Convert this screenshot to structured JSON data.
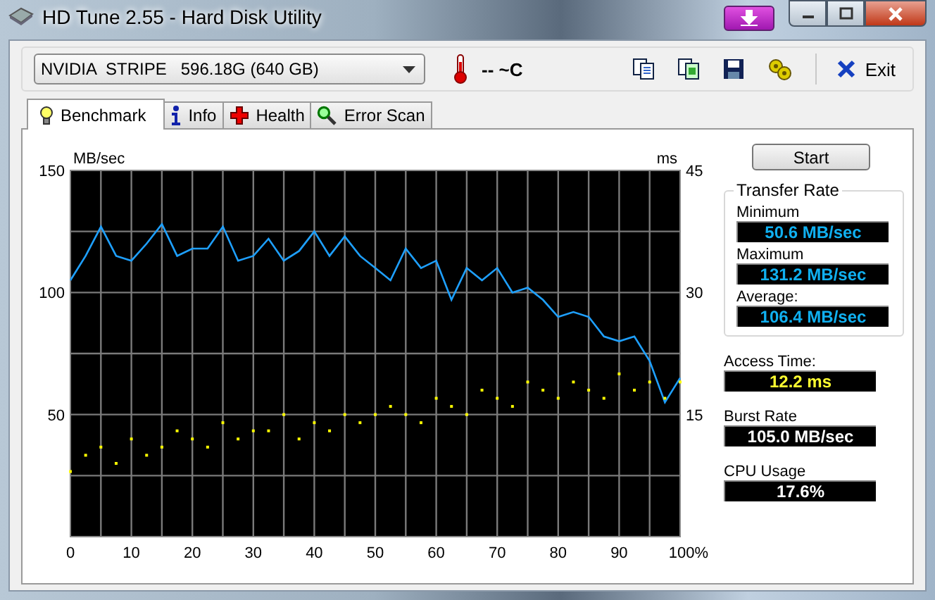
{
  "window": {
    "title": "HD Tune 2.55 - Hard Disk Utility"
  },
  "toolbar": {
    "drive": "NVIDIA  STRIPE   596.18G (640 GB)",
    "temperature": "-- ~C",
    "exit_label": "Exit"
  },
  "tabs": [
    {
      "label": "Benchmark",
      "selected": true,
      "kind": "bulb"
    },
    {
      "label": "Info",
      "selected": false,
      "kind": "info"
    },
    {
      "label": "Health",
      "selected": false,
      "kind": "health"
    },
    {
      "label": "Error Scan",
      "selected": false,
      "kind": "scan"
    }
  ],
  "benchmark": {
    "start_button": "Start",
    "transfer_rate": {
      "title": "Transfer Rate",
      "items": [
        {
          "label": "Minimum",
          "value": "50.6 MB/sec"
        },
        {
          "label": "Maximum",
          "value": "131.2 MB/sec"
        },
        {
          "label": "Average:",
          "value": "106.4 MB/sec"
        }
      ]
    },
    "stats": [
      {
        "label": "Access Time:",
        "value": "12.2 ms",
        "kind": "access"
      },
      {
        "label": "Burst Rate",
        "value": "105.0 MB/sec",
        "kind": "plain"
      },
      {
        "label": "CPU Usage",
        "value": "17.6%",
        "kind": "plain"
      }
    ],
    "chart_data": {
      "type": "line",
      "ylabel": "MB/sec",
      "y2label": "ms",
      "xlim": [
        0,
        100
      ],
      "ylim": [
        0,
        150
      ],
      "y2lim": [
        0,
        45
      ],
      "xticks": [
        0,
        10,
        20,
        30,
        40,
        50,
        60,
        70,
        80,
        90,
        {
          "value": 100,
          "label": "100%"
        }
      ],
      "yticks": [
        50,
        100,
        150
      ],
      "grid": true,
      "y2ticks": [
        15,
        30,
        45
      ],
      "x": [
        0,
        2.5,
        5,
        7.5,
        10,
        12.5,
        15,
        17.5,
        20,
        22.5,
        25,
        27.5,
        30,
        32.5,
        35,
        37.5,
        40,
        42.5,
        45,
        47.5,
        50,
        52.5,
        55,
        57.5,
        60,
        62.5,
        65,
        67.5,
        70,
        72.5,
        75,
        77.5,
        80,
        82.5,
        85,
        87.5,
        90,
        92.5,
        95,
        97.5,
        100
      ],
      "series": [
        {
          "color": "#1ea0ff",
          "values": [
            105,
            115,
            127,
            115,
            113,
            120,
            128,
            115,
            118,
            118,
            127,
            113,
            115,
            122,
            113,
            117,
            125,
            115,
            123,
            115,
            110,
            105,
            118,
            110,
            113,
            97,
            110,
            105,
            110,
            100,
            102,
            97,
            90,
            92,
            90,
            82,
            80,
            82,
            72,
            55,
            65
          ]
        },
        {
          "color": "#ffff00",
          "axis": "y2",
          "type": "scatter",
          "values": [
            8,
            10,
            11,
            9,
            12,
            10,
            11,
            13,
            12,
            11,
            14,
            12,
            13,
            13,
            15,
            12,
            14,
            13,
            15,
            14,
            15,
            16,
            15,
            14,
            17,
            16,
            15,
            18,
            17,
            16,
            19,
            18,
            17,
            19,
            18,
            17,
            20,
            18,
            19,
            17,
            19
          ]
        }
      ]
    }
  }
}
